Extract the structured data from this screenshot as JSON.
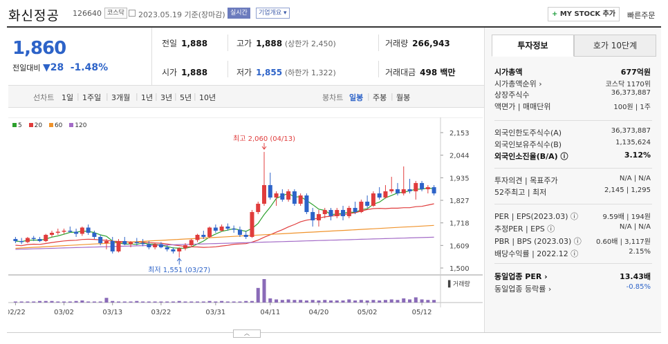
{
  "header": {
    "name": "화신정공",
    "code": "126640",
    "market_tag": "코스닥",
    "date": "2023.05.19 기준(장마감)",
    "realtime_tag": "실시간",
    "company_tag": "기업개요 ▾",
    "mystock_label": "MY STOCK 추가",
    "quick_order": "빠른주문"
  },
  "price": {
    "current": "1,860",
    "change_label": "전일대비",
    "change_value": "▼28",
    "change_rate": "-1.48%",
    "prev_label": "전일",
    "prev": "1,888",
    "open_label": "시가",
    "open": "1,888",
    "high_label": "고가",
    "high": "1,888",
    "upper_limit": "(상한가 2,450)",
    "low_label": "저가",
    "low": "1,855",
    "lower_limit": "(하한가 1,322)",
    "volume_label": "거래량",
    "volume": "266,943",
    "amount_label": "거래대금",
    "amount": "498 백만"
  },
  "periods": {
    "label": "선차트",
    "items": [
      "1일",
      "1주일",
      "3개월",
      "1년",
      "3년",
      "5년",
      "10년"
    ],
    "candle_label": "봉차트",
    "candle_items": [
      "일봉",
      "주봉",
      "월봉"
    ],
    "active_candle": "일봉"
  },
  "legend": [
    {
      "name": "5",
      "color": "#2ca02c"
    },
    {
      "name": "20",
      "color": "#e03c3c"
    },
    {
      "name": "60",
      "color": "#f0932b"
    },
    {
      "name": "120",
      "color": "#a36bc7"
    }
  ],
  "chart_data": {
    "type": "candlestick",
    "y_ticks": [
      "2,153",
      "2,044",
      "1,935",
      "1,827",
      "1,718",
      "1,609",
      "1,500"
    ],
    "ylim": [
      1500,
      2153
    ],
    "x_ticks": [
      "02/22",
      "03/02",
      "03/13",
      "03/22",
      "03/31",
      "04/11",
      "04/20",
      "05/02",
      "05/12"
    ],
    "high_annotation": "최고 2,060 (04/13)",
    "low_annotation": "최저 1,551 (03/27)",
    "volume_label": "거래량",
    "up_color": "#e03c3c",
    "down_color": "#2d63c8",
    "candles": [
      [
        1640,
        1650,
        1620,
        1630
      ],
      [
        1630,
        1645,
        1615,
        1625
      ],
      [
        1625,
        1650,
        1620,
        1645
      ],
      [
        1645,
        1655,
        1630,
        1640
      ],
      [
        1640,
        1650,
        1625,
        1630
      ],
      [
        1630,
        1665,
        1625,
        1660
      ],
      [
        1660,
        1680,
        1650,
        1670
      ],
      [
        1670,
        1690,
        1660,
        1675
      ],
      [
        1675,
        1690,
        1665,
        1680
      ],
      [
        1680,
        1700,
        1670,
        1675
      ],
      [
        1675,
        1690,
        1650,
        1665
      ],
      [
        1665,
        1700,
        1655,
        1695
      ],
      [
        1695,
        1710,
        1660,
        1670
      ],
      [
        1670,
        1680,
        1640,
        1650
      ],
      [
        1650,
        1660,
        1610,
        1620
      ],
      [
        1620,
        1640,
        1590,
        1630
      ],
      [
        1630,
        1650,
        1570,
        1580
      ],
      [
        1580,
        1640,
        1575,
        1630
      ],
      [
        1630,
        1650,
        1610,
        1615
      ],
      [
        1615,
        1630,
        1600,
        1625
      ],
      [
        1625,
        1645,
        1610,
        1620
      ],
      [
        1620,
        1640,
        1605,
        1615
      ],
      [
        1615,
        1630,
        1590,
        1600
      ],
      [
        1600,
        1620,
        1590,
        1615
      ],
      [
        1615,
        1625,
        1595,
        1600
      ],
      [
        1600,
        1610,
        1580,
        1590
      ],
      [
        1590,
        1600,
        1570,
        1580
      ],
      [
        1580,
        1600,
        1551,
        1595
      ],
      [
        1595,
        1620,
        1585,
        1610
      ],
      [
        1610,
        1640,
        1600,
        1635
      ],
      [
        1635,
        1665,
        1625,
        1660
      ],
      [
        1660,
        1680,
        1640,
        1650
      ],
      [
        1650,
        1700,
        1645,
        1695
      ],
      [
        1695,
        1710,
        1670,
        1680
      ],
      [
        1680,
        1710,
        1675,
        1700
      ],
      [
        1700,
        1715,
        1680,
        1690
      ],
      [
        1690,
        1705,
        1670,
        1685
      ],
      [
        1685,
        1700,
        1650,
        1660
      ],
      [
        1660,
        1680,
        1640,
        1650
      ],
      [
        1650,
        1780,
        1645,
        1770
      ],
      [
        1770,
        1820,
        1760,
        1810
      ],
      [
        1810,
        2060,
        1800,
        1900
      ],
      [
        1900,
        1960,
        1830,
        1840
      ],
      [
        1840,
        1870,
        1800,
        1860
      ],
      [
        1860,
        1880,
        1820,
        1830
      ],
      [
        1830,
        1880,
        1820,
        1870
      ],
      [
        1870,
        1880,
        1800,
        1810
      ],
      [
        1810,
        1860,
        1800,
        1850
      ],
      [
        1850,
        1860,
        1760,
        1770
      ],
      [
        1770,
        1790,
        1700,
        1730
      ],
      [
        1730,
        1780,
        1700,
        1760
      ],
      [
        1760,
        1790,
        1740,
        1780
      ],
      [
        1780,
        1790,
        1730,
        1750
      ],
      [
        1750,
        1790,
        1740,
        1780
      ],
      [
        1780,
        1800,
        1730,
        1750
      ],
      [
        1750,
        1800,
        1740,
        1790
      ],
      [
        1790,
        1820,
        1760,
        1770
      ],
      [
        1770,
        1830,
        1765,
        1820
      ],
      [
        1820,
        1850,
        1790,
        1800
      ],
      [
        1800,
        1870,
        1795,
        1860
      ],
      [
        1860,
        1890,
        1830,
        1840
      ],
      [
        1840,
        1900,
        1835,
        1870
      ],
      [
        1870,
        1940,
        1860,
        1880
      ],
      [
        1880,
        1910,
        1850,
        1860
      ],
      [
        1860,
        1990,
        1850,
        1880
      ],
      [
        1880,
        1930,
        1860,
        1870
      ],
      [
        1870,
        1920,
        1830,
        1910
      ],
      [
        1910,
        1920,
        1870,
        1880
      ],
      [
        1880,
        1900,
        1860,
        1890
      ],
      [
        1890,
        1900,
        1850,
        1860
      ]
    ],
    "volumes": [
      2,
      2,
      2,
      2,
      3,
      3,
      3,
      2,
      2,
      2,
      3,
      4,
      2,
      2,
      2,
      9,
      3,
      2,
      2,
      2,
      3,
      2,
      2,
      2,
      2,
      2,
      2,
      3,
      2,
      2,
      2,
      2,
      3,
      2,
      3,
      2,
      2,
      2,
      3,
      3,
      28,
      45,
      8,
      6,
      5,
      6,
      5,
      5,
      4,
      5,
      4,
      5,
      4,
      4,
      4,
      6,
      4,
      5,
      4,
      5,
      4,
      5,
      6,
      5,
      8,
      6,
      10,
      6,
      5,
      5
    ]
  },
  "right_panel": {
    "tabs": [
      "투자정보",
      "호가 10단계"
    ],
    "rows1": [
      {
        "label": "시가총액",
        "value": "677억원",
        "strong": true
      },
      {
        "label": "시가총액순위 ›",
        "value": "코스닥 1170위"
      },
      {
        "label": "상장주식수",
        "value": "36,373,887"
      },
      {
        "label": "액면가 | 매매단위",
        "value": "100원 | 1주"
      }
    ],
    "rows2": [
      {
        "label": "외국인한도주식수(A)",
        "value": "36,373,887"
      },
      {
        "label": "외국인보유주식수(B)",
        "value": "1,135,624"
      },
      {
        "label": "외국인소진율(B/A) ⓘ",
        "value": "3.12%",
        "strong": true
      }
    ],
    "rows3": [
      {
        "label": "투자의견 | 목표주가",
        "value": "N/A | N/A"
      },
      {
        "label": "52주최고 | 최저",
        "value": "2,145 | 1,295"
      }
    ],
    "rows4": [
      {
        "label": "PER | EPS(2023.03) ⓘ",
        "value": "9.59배 | 194원"
      },
      {
        "label": "추정PER | EPS ⓘ",
        "value": "N/A | N/A"
      },
      {
        "label": "PBR | BPS (2023.03) ⓘ",
        "value": "0.60배 | 3,117원"
      },
      {
        "label": "배당수익률 | 2022.12 ⓘ",
        "value": "2.15%"
      }
    ],
    "rows5": [
      {
        "label": "동일업종 PER ›",
        "value": "13.43배",
        "strong": true
      },
      {
        "label": "동일업종 등락률 ›",
        "value": "-0.85%",
        "neg": true
      }
    ]
  }
}
